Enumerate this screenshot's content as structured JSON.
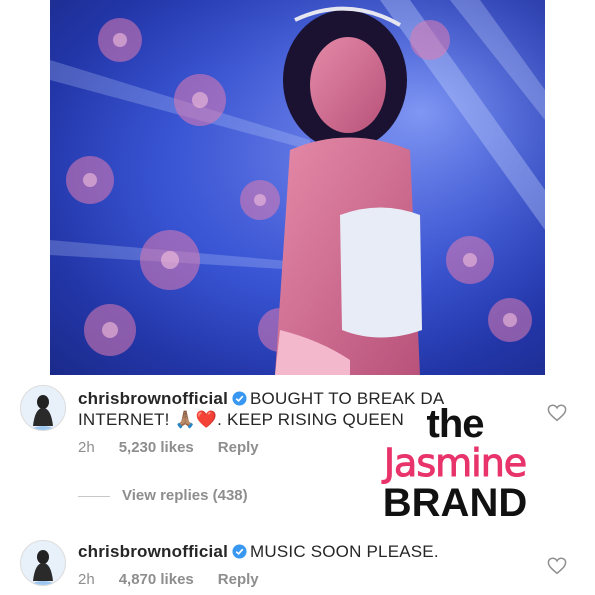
{
  "post": {
    "image_alt": "photo"
  },
  "comments": [
    {
      "username": "chrisbrownofficial",
      "text": "BOUGHT TO BREAK DA INTERNET! 🙏🏽❤️. KEEP RISING QUEEN",
      "text_line1": "BOUGHT TO BREAK DA",
      "text_line2": "INTERNET! 🙏🏽❤️. KEEP RISING QUEEN",
      "time": "2h",
      "likes": "5,230 likes",
      "reply": "Reply"
    },
    {
      "username": "chrisbrownofficial",
      "text": "MUSIC SOON PLEASE.",
      "time": "2h",
      "likes": "4,870 likes",
      "reply": "Reply"
    }
  ],
  "view_replies": "View replies (438)",
  "watermark": {
    "line1": "the",
    "line2": "Jasmine",
    "line3": "BRAND"
  },
  "colors": {
    "verified": "#3897f0",
    "brand_pink": "#e8336b",
    "meta_gray": "#8e8e8e"
  },
  "icons": {
    "heart": "heart-outline-icon",
    "verified": "verified-badge-icon"
  }
}
